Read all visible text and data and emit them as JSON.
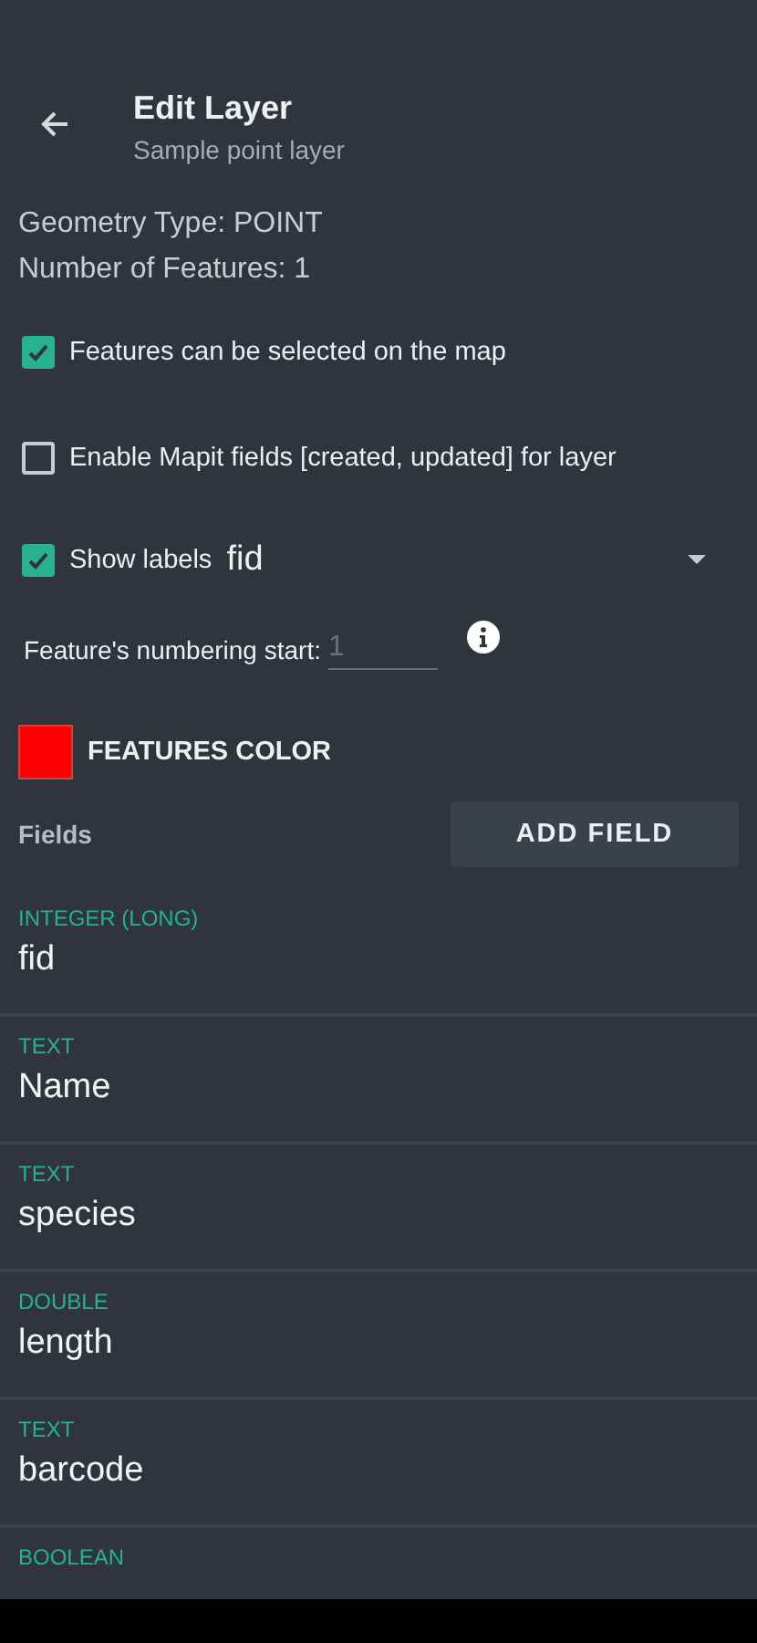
{
  "header": {
    "title": "Edit Layer",
    "subtitle": "Sample point layer"
  },
  "info": [
    "Geometry Type: POINT",
    "Number of Features: 1"
  ],
  "options": [
    {
      "label": "Features can be selected on the map",
      "checked": true
    },
    {
      "label": "Enable Mapit fields [created, updated] for layer",
      "checked": false
    }
  ],
  "show_labels": {
    "label": "Show labels",
    "checked": true,
    "value": "fid"
  },
  "numbering": {
    "label": "Feature's numbering start:",
    "placeholder": "1"
  },
  "features_color": {
    "label": "FEATURES COLOR",
    "color": "#ff0000"
  },
  "fields_section": {
    "title": "Fields",
    "button": "ADD FIELD"
  },
  "fields": [
    {
      "type": "INTEGER (LONG)",
      "name": "fid"
    },
    {
      "type": "TEXT",
      "name": "Name"
    },
    {
      "type": "TEXT",
      "name": "species"
    },
    {
      "type": "DOUBLE",
      "name": "length"
    },
    {
      "type": "TEXT",
      "name": "barcode"
    },
    {
      "type": "BOOLEAN"
    }
  ]
}
